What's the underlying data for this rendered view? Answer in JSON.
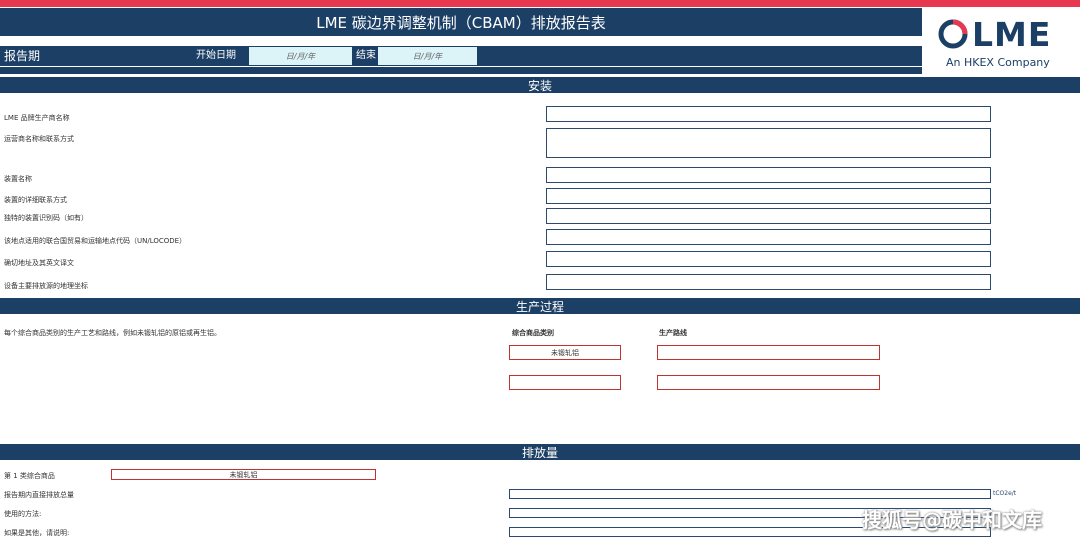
{
  "header": {
    "title": "LME 碳边界调整机制（CBAM）排放报告表"
  },
  "logo": {
    "name": "LME",
    "subtitle": "An HKEX Company",
    "colors": {
      "primary": "#1c3f66",
      "accent": "#e8384f"
    }
  },
  "period": {
    "label": "报告期",
    "start_label": "开始日期",
    "start_value": "日/月/年",
    "end_label": "结束",
    "end_value": "日/月/年"
  },
  "installation": {
    "heading": "安装",
    "rows": [
      {
        "label": "LME 品牌生产商名称"
      },
      {
        "label": "运营商名称和联系方式"
      },
      {
        "label": "装置名称"
      },
      {
        "label": "装置的详细联系方式"
      },
      {
        "label": "独特的装置识别码（如有）"
      },
      {
        "label": "该地点适用的联合国贸易和运输地点代码（UN/LOCODE）"
      },
      {
        "label": "确切地址及其英文译文"
      },
      {
        "label": "设备主要排放源的地理坐标"
      }
    ]
  },
  "production": {
    "heading": "生产过程",
    "description": "每个综合商品类别的生产工艺和路线，例如未锻轧铝的原铝或再生铝。",
    "col_category": "综合商品类别",
    "col_route": "生产路线",
    "rows": [
      {
        "category": "未锻轧铝",
        "route": ""
      },
      {
        "category": "",
        "route": ""
      }
    ]
  },
  "emissions": {
    "heading": "排放量",
    "goods_label": "第 1 类综合商品",
    "goods_value": "未锻轧铝",
    "direct_label": "报告期内直接排放总量",
    "unit": "tCO2e/t",
    "method_label": "使用的方法:",
    "other_label": "如果是其他，请说明:"
  },
  "watermark": "搜狐号@碳中和文库"
}
